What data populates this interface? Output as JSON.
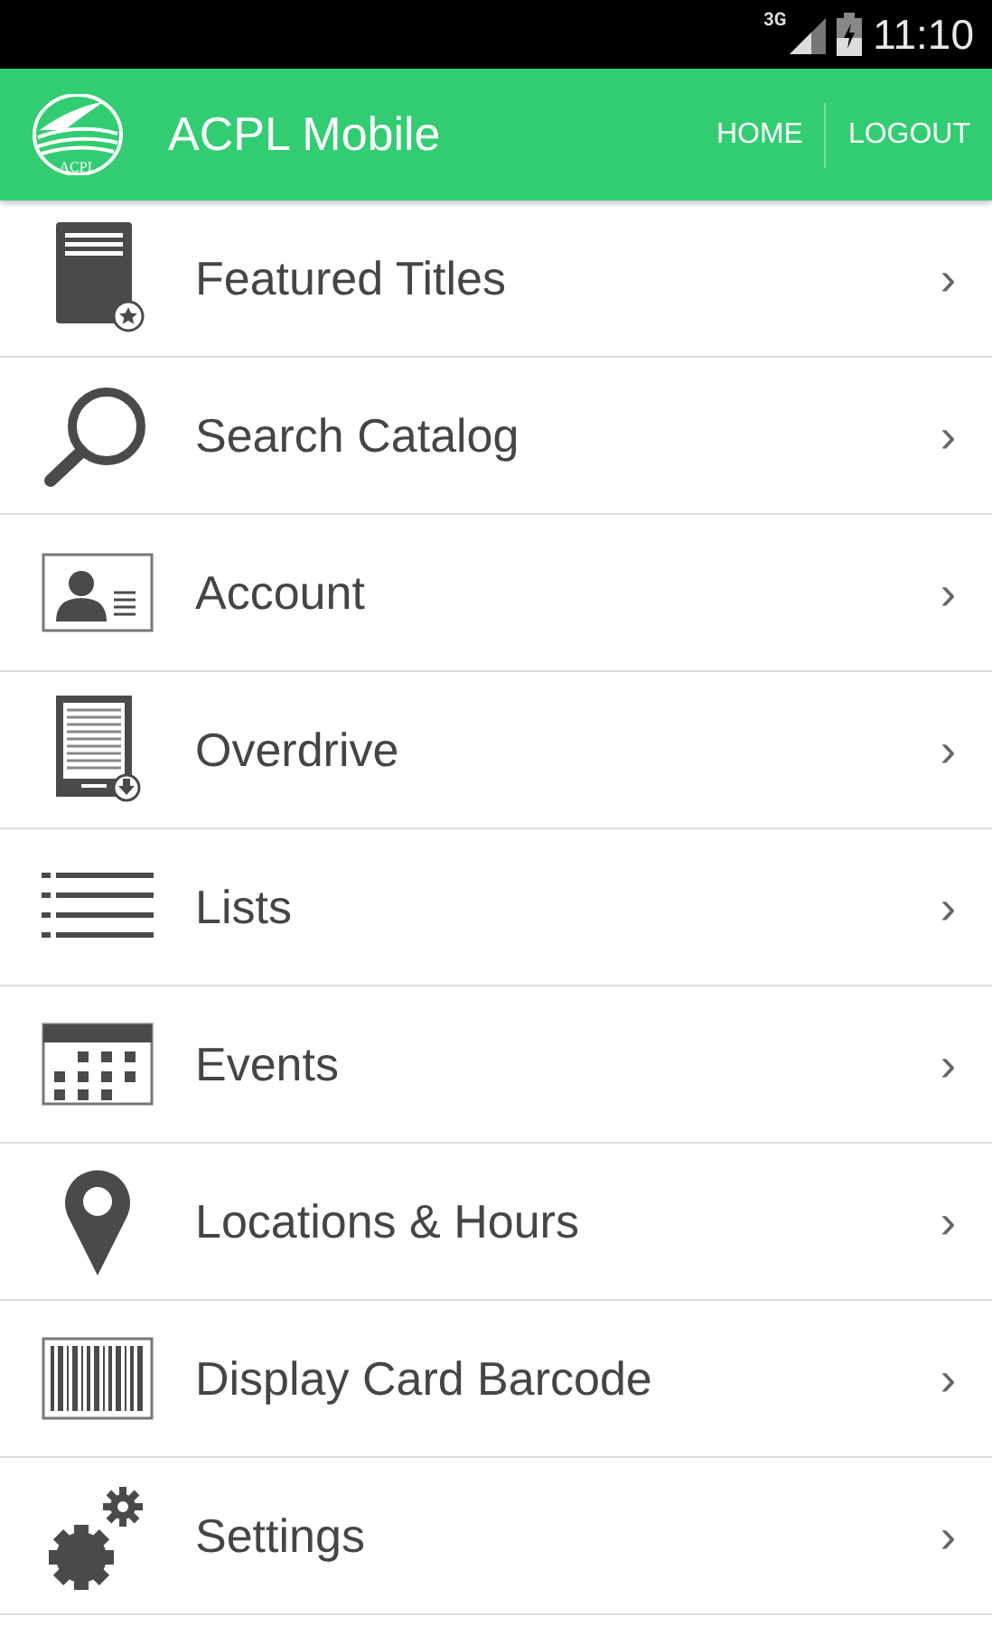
{
  "status_bar": {
    "network": "3G",
    "time": "11:10"
  },
  "header": {
    "logo_text": "ACPL",
    "title": "ACPL Mobile",
    "actions": [
      "HOME",
      "LOGOUT"
    ]
  },
  "menu": [
    {
      "kind": "book",
      "label": "Featured Titles",
      "chevron": "›"
    },
    {
      "kind": "search",
      "label": "Search Catalog",
      "chevron": "›"
    },
    {
      "kind": "card",
      "label": "Account",
      "chevron": "›"
    },
    {
      "kind": "ereader",
      "label": "Overdrive",
      "chevron": "›"
    },
    {
      "kind": "list",
      "label": "Lists",
      "chevron": "›"
    },
    {
      "kind": "calendar",
      "label": "Events",
      "chevron": "›"
    },
    {
      "kind": "pin",
      "label": "Locations & Hours",
      "chevron": "›"
    },
    {
      "kind": "barcode",
      "label": "Display Card Barcode",
      "chevron": "›"
    },
    {
      "kind": "gears",
      "label": "Settings",
      "chevron": "›"
    }
  ]
}
